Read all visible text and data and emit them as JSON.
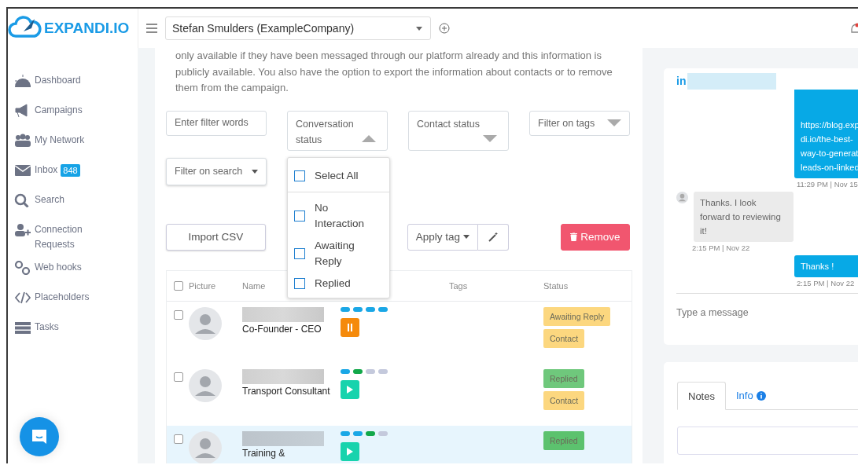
{
  "brand": "EXPANDI.IO",
  "account_select": {
    "value": "Stefan Smulders (ExampleCompany)"
  },
  "sidebar": {
    "items": [
      {
        "label": "Dashboard"
      },
      {
        "label": "Campaigns"
      },
      {
        "label": "My Network"
      },
      {
        "label": "Inbox",
        "badge": "848"
      },
      {
        "label": "Search"
      },
      {
        "label": "Connection Requests"
      },
      {
        "label": "Web hooks"
      },
      {
        "label": "Placeholders"
      },
      {
        "label": "Tasks"
      }
    ]
  },
  "intro_text": "only available if they have been messaged through our platform already and this information is publicly available. You also have the option to export the information about contacts or to remove them from the campaign.",
  "filters": {
    "filter_words": {
      "placeholder": "Enter filter words"
    },
    "conversation_status": {
      "label": "Conversation status",
      "expanded": true
    },
    "contact_status": {
      "label": "Contact status",
      "expanded": false
    },
    "filter_tags": {
      "label": "Filter on tags"
    },
    "filter_search": {
      "label": "Filter on search"
    }
  },
  "conversation_options": [
    {
      "kind": "select-all",
      "label": "Select All",
      "checked": false
    },
    {
      "kind": "option",
      "label": "No Interaction",
      "checked": false
    },
    {
      "kind": "option",
      "label": "Awaiting Reply",
      "checked": false
    },
    {
      "kind": "option",
      "label": "Replied",
      "checked": false
    }
  ],
  "actions": {
    "import": "Import CSV",
    "apply_tag": "Apply tag",
    "remove": "Remove"
  },
  "table": {
    "all_checked": false,
    "columns": [
      "Picture",
      "Name",
      "Tags",
      "Status"
    ],
    "rows": [
      {
        "selected": false,
        "title": "Co-Founder - CEO",
        "steps": [
          {
            "color": "#1aa7e6"
          },
          {
            "color": "#1aa7e6"
          },
          {
            "color": "#1aa7e6"
          },
          {
            "color": "#1aa7e6"
          }
        ],
        "paused": true,
        "tags": [
          {
            "label": "Awaiting Reply",
            "color": "#fcd77f"
          },
          {
            "label": "Contact",
            "color": "#fcd77f"
          }
        ]
      },
      {
        "selected": false,
        "title": "Transport Consultant",
        "steps": [
          {
            "color": "#1aa7e6"
          },
          {
            "color": "#12a84a"
          },
          {
            "color": "#c4c9dc"
          },
          {
            "color": "#c4c9dc"
          }
        ],
        "paused": false,
        "tags": [
          {
            "label": "Replied",
            "color": "#6fc87c"
          },
          {
            "label": "Contact",
            "color": "#fcd77f"
          }
        ]
      },
      {
        "selected": true,
        "title": "Training &",
        "steps": [
          {
            "color": "#1aa7e6"
          },
          {
            "color": "#1aa7e6"
          },
          {
            "color": "#12a84a"
          },
          {
            "color": "#c4c9dc"
          }
        ],
        "paused": false,
        "tags": [
          {
            "label": "Replied",
            "color": "#5cc26e"
          }
        ]
      }
    ]
  },
  "chat": {
    "network_label": "in",
    "messages": [
      {
        "kind": "outgoing",
        "lines": [
          "https://blog.exp",
          "di.io/the-best-",
          "way-to-generat",
          "leads-on-linked"
        ],
        "time": "11:29 PM | Nov 15"
      },
      {
        "kind": "incoming",
        "lines": [
          "Thanks. I look",
          "forward to reviewing",
          "it!"
        ],
        "time": "2:15 PM | Nov 22"
      },
      {
        "kind": "outgoing",
        "lines": [
          "Thanks !"
        ],
        "time": "2:15 PM | Nov 22"
      }
    ],
    "input": {
      "placeholder": "Type a message"
    }
  },
  "detail_tabs": [
    {
      "label": "Notes",
      "selected": true
    },
    {
      "label": "Info",
      "selected": false
    }
  ]
}
